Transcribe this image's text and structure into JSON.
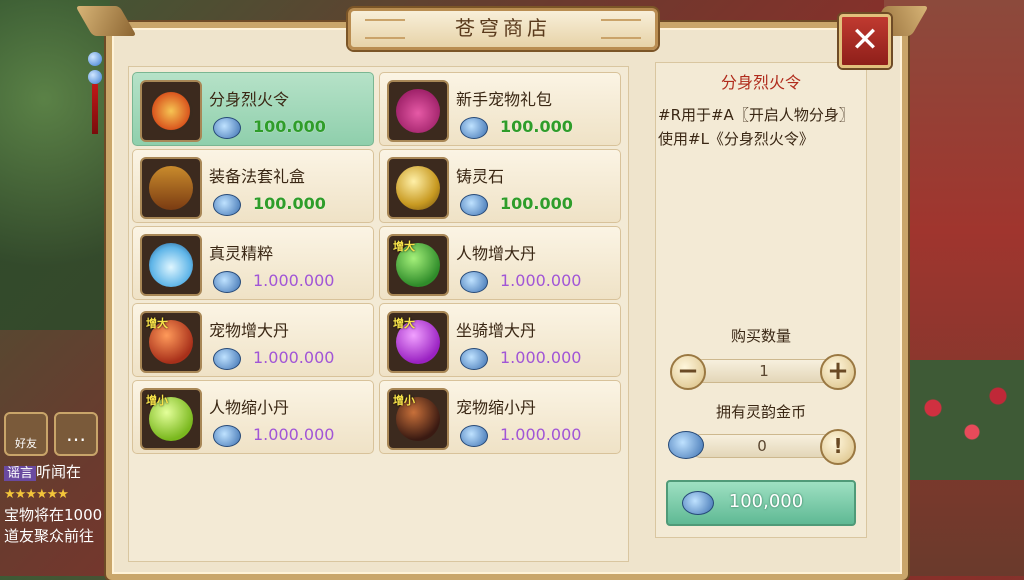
{
  "window": {
    "title": "苍穹商店",
    "close_label": "✕"
  },
  "chat": {
    "friend_label": "好友",
    "tag": "谣言",
    "line1": "听闻在",
    "stars": "★★★★★★",
    "line3": "宝物将在1000",
    "line4": "道友聚众前往"
  },
  "items": [
    {
      "name": "分身烈火令",
      "price": "100.000",
      "price_color": "green",
      "selected": true,
      "badge": "",
      "icon": "flame-token-icon"
    },
    {
      "name": "新手宠物礼包",
      "price": "100.000",
      "price_color": "green",
      "selected": false,
      "badge": "",
      "icon": "gift-bag-icon"
    },
    {
      "name": "装备法套礼盒",
      "price": "100.000",
      "price_color": "green",
      "selected": false,
      "badge": "",
      "icon": "treasure-chest-icon"
    },
    {
      "name": "铸灵石",
      "price": "100.000",
      "price_color": "green",
      "selected": false,
      "badge": "",
      "icon": "golden-orb-icon"
    },
    {
      "name": "真灵精粹",
      "price": "1.000.000",
      "price_color": "purple",
      "selected": false,
      "badge": "",
      "icon": "spirit-vase-icon"
    },
    {
      "name": "人物增大丹",
      "price": "1.000.000",
      "price_color": "purple",
      "selected": false,
      "badge": "增大",
      "icon": "green-pill-icon"
    },
    {
      "name": "宠物增大丹",
      "price": "1.000.000",
      "price_color": "purple",
      "selected": false,
      "badge": "增大",
      "icon": "red-pill-icon"
    },
    {
      "name": "坐骑增大丹",
      "price": "1.000.000",
      "price_color": "purple",
      "selected": false,
      "badge": "增大",
      "icon": "purple-pill-icon"
    },
    {
      "name": "人物缩小丹",
      "price": "1.000.000",
      "price_color": "purple",
      "selected": false,
      "badge": "增小",
      "icon": "lime-pill-icon"
    },
    {
      "name": "宠物缩小丹",
      "price": "1.000.000",
      "price_color": "purple",
      "selected": false,
      "badge": "增小",
      "icon": "dark-pill-icon"
    }
  ],
  "detail": {
    "title": "分身烈火令",
    "description": "#R用于#A〖开启人物分身〗使用#L《分身烈火令》",
    "qty_label": "购买数量",
    "qty_value": "1",
    "minus": "−",
    "plus": "+",
    "own_label": "拥有灵韵金币",
    "own_value": "0",
    "own_info": "!",
    "buy_price": "100,000"
  },
  "colors": {
    "price_green": "#2f9d2a",
    "price_purple": "#a155d6",
    "selected_bg": "#9fd8b8",
    "title_red": "#b02b1c"
  }
}
